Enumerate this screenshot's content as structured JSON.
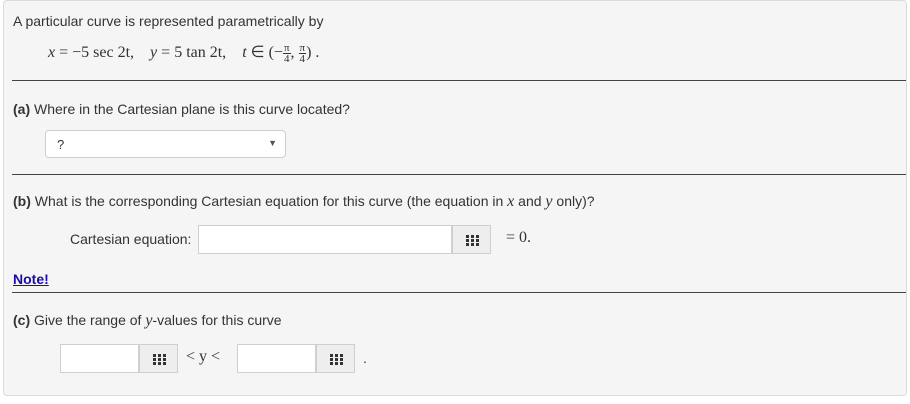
{
  "intro": "A particular curve is represented parametrically by",
  "param_eq": {
    "x_lhs": "x",
    "x_rhs": "−5 sec 2t,",
    "y_lhs": "y",
    "y_rhs": "5 tan 2t,",
    "t": "t",
    "in": "∈",
    "interval_open": "(−",
    "pi": "π",
    "four": "4",
    "comma": ",",
    "interval_close": ") ."
  },
  "part_a": {
    "label": "(a)",
    "question": "Where in the Cartesian plane is this curve located?",
    "select_value": "?"
  },
  "part_b": {
    "label": "(b)",
    "question_pre": "What is the corresponding Cartesian equation for this curve (the equation in ",
    "x": "x",
    "and": " and ",
    "y": "y",
    "question_post": " only)?",
    "field_label": "Cartesian equation:",
    "field_value": "",
    "equals_zero": "= 0."
  },
  "note": "Note!",
  "part_c": {
    "label": "(c)",
    "question_pre": "Give the range of ",
    "y": "y",
    "question_post": "-values for this curve",
    "lower_value": "",
    "mid": "< y <",
    "upper_value": "",
    "period": "."
  }
}
